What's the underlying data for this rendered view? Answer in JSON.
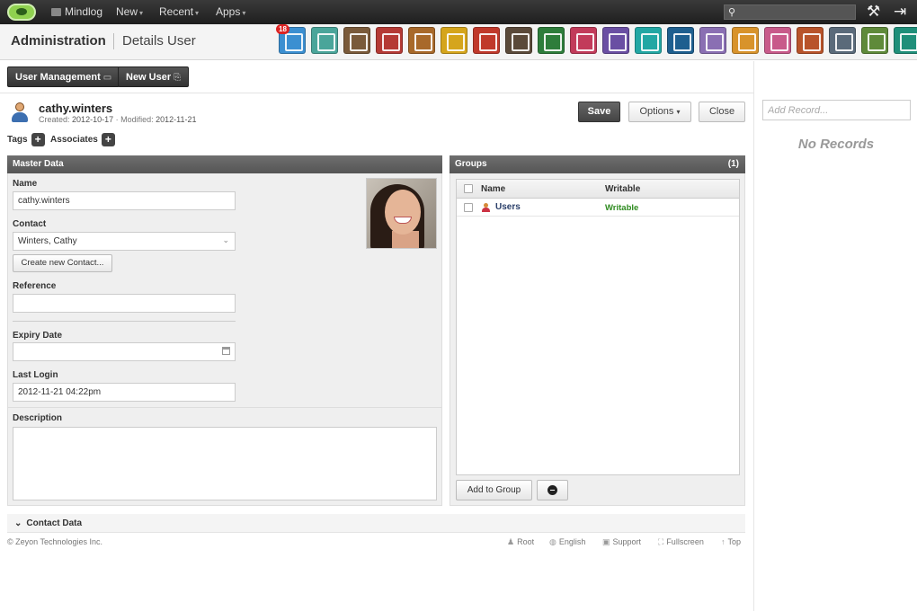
{
  "topnav": {
    "mindlog": "Mindlog",
    "new": "New",
    "recent": "Recent",
    "apps": "Apps",
    "search_placeholder": ""
  },
  "header": {
    "section": "Administration",
    "page": "Details User",
    "apps": [
      {
        "name": "mail-app-icon",
        "color": "#3b8fd1",
        "badge": "18"
      },
      {
        "name": "addressbook-app-icon",
        "color": "#4aa59a"
      },
      {
        "name": "contacts-app-icon",
        "color": "#7a5a3a"
      },
      {
        "name": "calendar-app-icon",
        "color": "#b53a35"
      },
      {
        "name": "folder-app-icon",
        "color": "#a8692a"
      },
      {
        "name": "tasks-app-icon",
        "color": "#d5a51c"
      },
      {
        "name": "timer-app-icon",
        "color": "#c0392b"
      },
      {
        "name": "notes-app-icon",
        "color": "#5b4a3a"
      },
      {
        "name": "bookmark-app-icon",
        "color": "#2e7d3b"
      },
      {
        "name": "cashdesk-app-icon",
        "color": "#c23b5a"
      },
      {
        "name": "finance-app-icon",
        "color": "#6a4fa3"
      },
      {
        "name": "delivery-app-icon",
        "color": "#22a7a4"
      },
      {
        "name": "support-app-icon",
        "color": "#1e5f8f"
      },
      {
        "name": "documents-app-icon",
        "color": "#8a6fb3"
      },
      {
        "name": "contracts-app-icon",
        "color": "#d8932b"
      },
      {
        "name": "partners-app-icon",
        "color": "#c85a8a"
      },
      {
        "name": "campaign-app-icon",
        "color": "#b8532a"
      },
      {
        "name": "shipping-app-icon",
        "color": "#5a6a7a"
      },
      {
        "name": "pricing-app-icon",
        "color": "#5f8a3a"
      },
      {
        "name": "lab-app-icon",
        "color": "#1f8f7a"
      }
    ]
  },
  "toolbar": {
    "user_management": "User Management",
    "new_user": "New User"
  },
  "user": {
    "username": "cathy.winters",
    "created_label": "Created:",
    "created": "2012-10-17",
    "modified_label": "Modified:",
    "modified": "2012-11-21",
    "tags_label": "Tags",
    "associates_label": "Associates"
  },
  "actions": {
    "save": "Save",
    "options": "Options",
    "close": "Close"
  },
  "master": {
    "title": "Master Data",
    "name_label": "Name",
    "name_value": "cathy.winters",
    "contact_label": "Contact",
    "contact_value": "Winters, Cathy",
    "create_contact": "Create new Contact...",
    "reference_label": "Reference",
    "reference_value": "",
    "expiry_label": "Expiry Date",
    "expiry_value": "",
    "last_login_label": "Last Login",
    "last_login_value": "2012-11-21 04:22pm",
    "description_label": "Description",
    "description_value": ""
  },
  "groups": {
    "title": "Groups",
    "count": "(1)",
    "col_name": "Name",
    "col_writable": "Writable",
    "rows": [
      {
        "name": "Users",
        "writable": "Writable"
      }
    ],
    "add_to_group": "Add to Group"
  },
  "sidebar": {
    "add_record_placeholder": "Add Record...",
    "no_records": "No Records"
  },
  "contact_data": {
    "title": "Contact Data"
  },
  "footer": {
    "copyright": "© Zeyon Technologies Inc.",
    "root": "Root",
    "english": "English",
    "support": "Support",
    "fullscreen": "Fullscreen",
    "top": "Top"
  },
  "colors": {
    "topbar": "#2a2a2a",
    "panel_header": "#5f5f5f",
    "writable_green": "#2e8b1f",
    "group_link": "#2a3f6a"
  }
}
